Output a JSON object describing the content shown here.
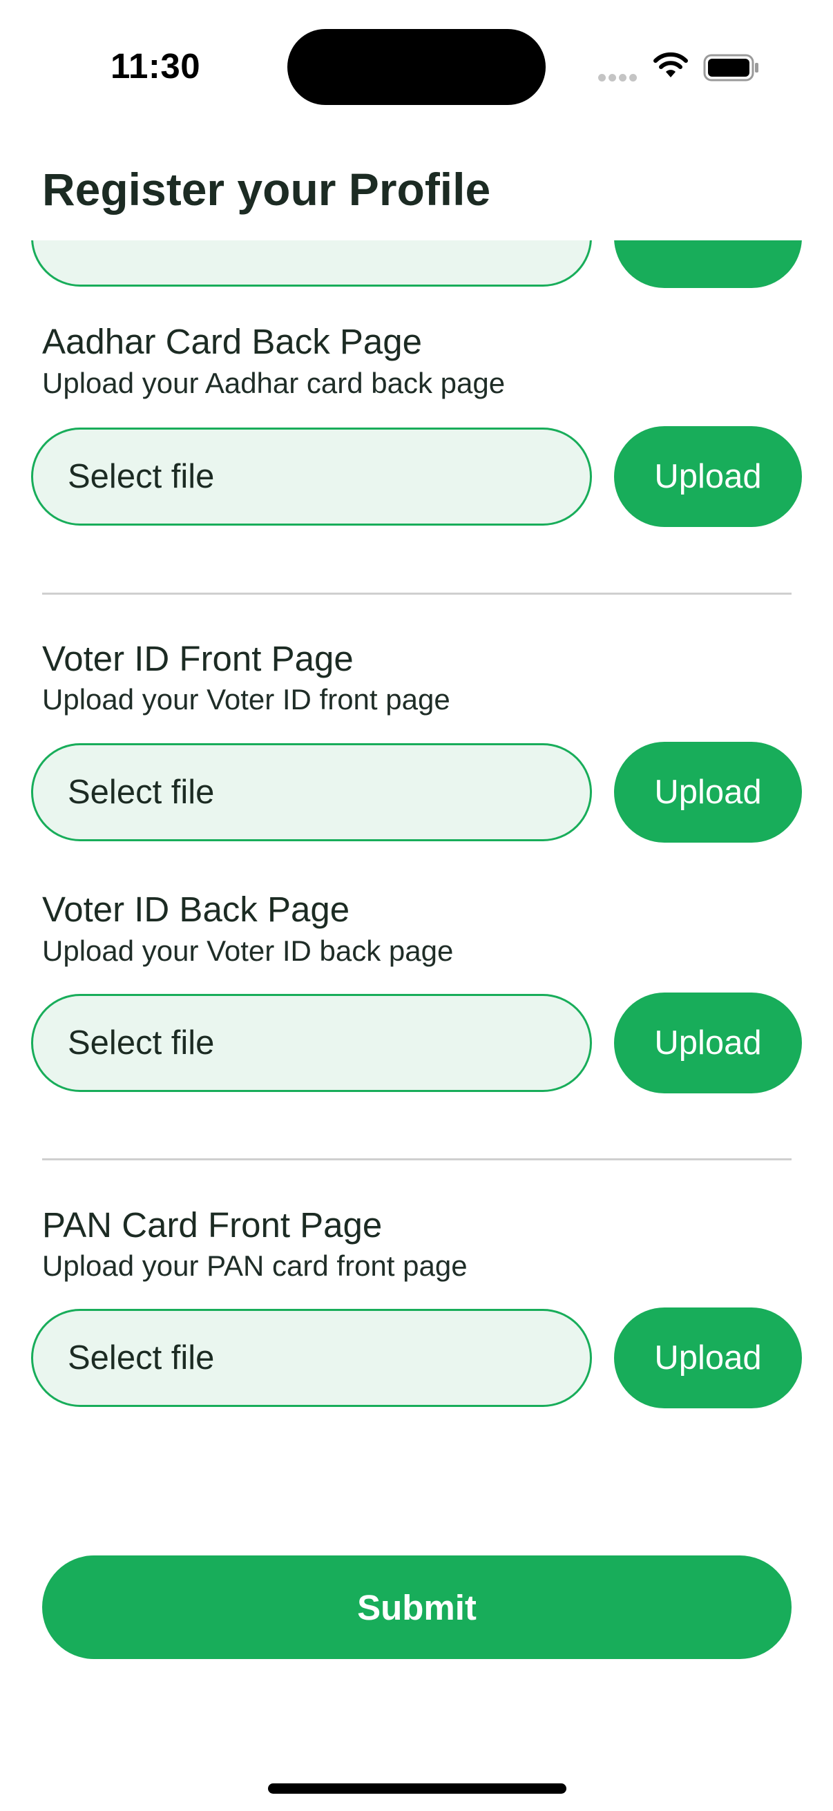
{
  "status_bar": {
    "time": "11:30"
  },
  "header": {
    "title": "Register your Profile"
  },
  "uploads": [
    {
      "title": "Aadhar Card Back Page",
      "subtitle": "Upload your Aadhar card back page",
      "placeholder": "Select file",
      "button": "Upload"
    },
    {
      "title": "Voter ID Front Page",
      "subtitle": "Upload your Voter ID front page",
      "placeholder": "Select file",
      "button": "Upload"
    },
    {
      "title": "Voter ID Back Page",
      "subtitle": "Upload your Voter ID back page",
      "placeholder": "Select file",
      "button": "Upload"
    },
    {
      "title": "PAN Card Front Page",
      "subtitle": "Upload your PAN card front page",
      "placeholder": "Select file",
      "button": "Upload"
    }
  ],
  "actions": {
    "submit": "Submit"
  },
  "colors": {
    "accent": "#18ad5a",
    "field_background": "#eaf6ef",
    "text": "#1c2b23",
    "divider": "#cfcfcf"
  },
  "icons": {
    "signal": "cellular-dots-icon",
    "wifi": "wifi-icon",
    "battery": "battery-icon"
  }
}
